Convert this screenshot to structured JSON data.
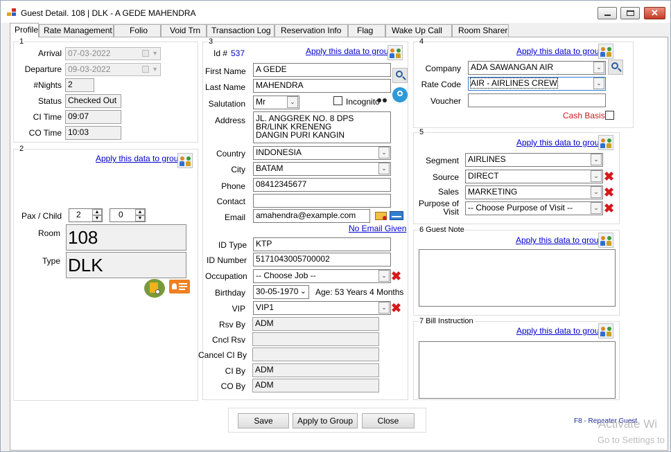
{
  "window": {
    "title": "Guest Detail. 108 | DLK - A GEDE MAHENDRA"
  },
  "tabs": [
    "Profile",
    "Rate Management",
    "Folio",
    "Void Trn",
    "Transaction Log",
    "Reservation Info",
    "Flag",
    "Wake Up Call",
    "Room Sharer"
  ],
  "g1": {
    "num": "1",
    "arrival_label": "Arrival",
    "arrival": "07-03-2022",
    "departure_label": "Departure",
    "departure": "09-03-2022",
    "nights_label": "#Nights",
    "nights": "2",
    "status_label": "Status",
    "status": "Checked Out",
    "ci_label": "CI Time",
    "ci": "09:07",
    "co_label": "CO Time",
    "co": "10:03"
  },
  "g2": {
    "num": "2",
    "apply": "Apply this data to group",
    "pax_label": "Pax / Child",
    "pax": "2",
    "child": "0",
    "room_label": "Room",
    "room": "108",
    "type_label": "Type",
    "type": "DLK"
  },
  "g3": {
    "num": "3",
    "id_label": "Id #",
    "id": "537",
    "apply": "Apply this data to group",
    "first_label": "First Name",
    "first": "A GEDE",
    "last_label": "Last Name",
    "last": "MAHENDRA",
    "sal_label": "Salutation",
    "sal": "Mr",
    "incognito": "Incognito",
    "addr_label": "Address",
    "addr1": "JL. ANGGREK NO. 8 DPS",
    "addr2": "BR/LINK KRENENG",
    "addr3": "DANGIN PURI KANGIN",
    "country_label": "Country",
    "country": "INDONESIA",
    "city_label": "City",
    "city": "BATAM",
    "phone_label": "Phone",
    "phone": "08412345677",
    "contact_label": "Contact",
    "contact": "",
    "email_label": "Email",
    "email": "amahendra@example.com",
    "no_email": "No Email Given",
    "idtype_label": "ID Type",
    "idtype": "KTP",
    "idnum_label": "ID Number",
    "idnum": "5171043005700002",
    "occ_label": "Occupation",
    "occ": "-- Choose Job --",
    "bday_label": "Birthday",
    "bday": "30-05-1970",
    "age": "Age: 53 Years  4 Months",
    "vip_label": "VIP",
    "vip": "VIP1",
    "rsv_label": "Rsv By",
    "rsv": "ADM",
    "cncl_label": "Cncl Rsv",
    "cncl": "",
    "cancel_label": "Cancel CI By",
    "cancel": "",
    "ciby_label": "CI By",
    "ciby": "ADM",
    "coby_label": "CO By",
    "coby": "ADM"
  },
  "g4": {
    "num": "4",
    "apply": "Apply this data to group",
    "company_label": "Company",
    "company": "ADA SAWANGAN AIR",
    "rate_label": "Rate Code",
    "rate": "AIR - AIRLINES CREW",
    "voucher_label": "Voucher",
    "voucher": "",
    "cash": "Cash Basis"
  },
  "g5": {
    "num": "5",
    "apply": "Apply this data to group",
    "seg_label": "Segment",
    "seg": "AIRLINES",
    "src_label": "Source",
    "src": "DIRECT",
    "sales_label": "Sales",
    "sales": "MARKETING",
    "purpose_label1": "Purpose of",
    "purpose_label2": "Visit",
    "purpose": "-- Choose Purpose of Visit --"
  },
  "g6": {
    "title": "6 Guest Note",
    "apply": "Apply this data to group"
  },
  "g7": {
    "title": "7 Bill Instruction",
    "apply": "Apply this data to group"
  },
  "buttons": {
    "save": "Save",
    "apply_group": "Apply to Group",
    "close": "Close"
  },
  "footer": {
    "f8": "F8 - Repeater Guest",
    "activate1": "Activate Wi",
    "activate2": "Go to Settings to"
  }
}
